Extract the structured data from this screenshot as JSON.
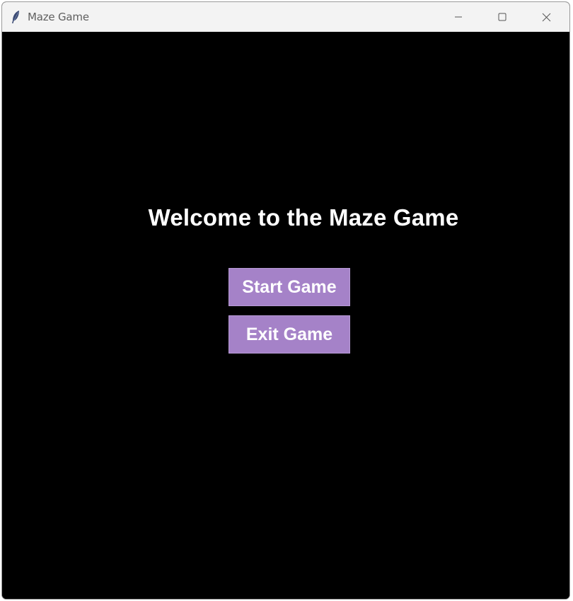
{
  "window": {
    "title": "Maze Game",
    "icon": "feather-icon",
    "controls": [
      "minimize-icon",
      "maximize-icon",
      "close-icon"
    ]
  },
  "main": {
    "heading": "Welcome to the Maze Game",
    "start_label": "Start Game",
    "exit_label": "Exit Game"
  },
  "colors": {
    "background": "#000000",
    "button": "#a582c8",
    "text": "#ffffff",
    "titlebar": "#f3f3f3"
  }
}
